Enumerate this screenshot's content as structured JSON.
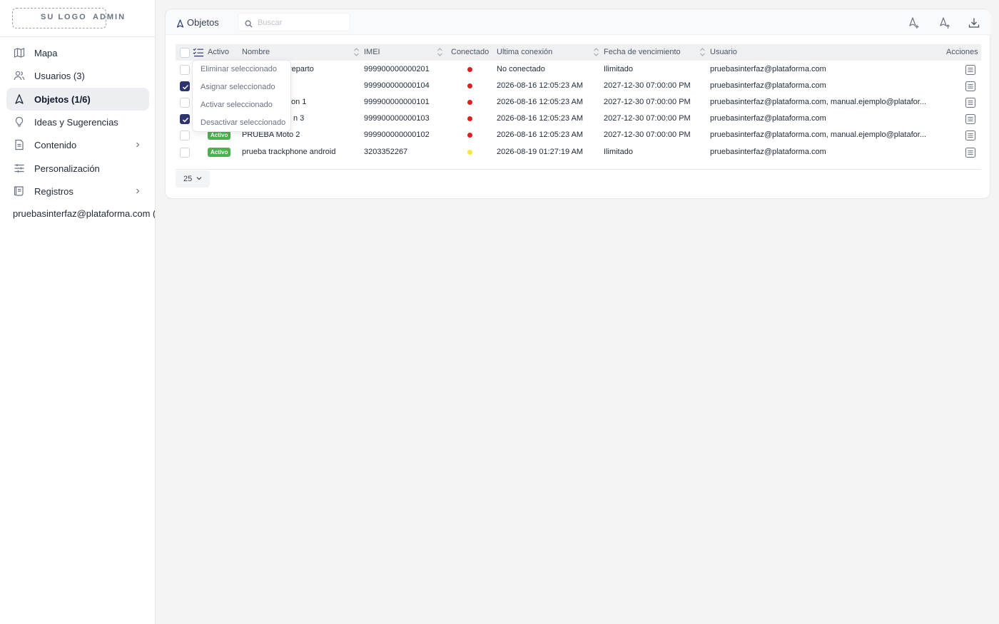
{
  "brand": {
    "logo": "SU LOGO",
    "role": "ADMIN"
  },
  "sidebar": {
    "items": [
      {
        "label": "Mapa",
        "icon": "map-icon"
      },
      {
        "label": "Usuarios (3)",
        "icon": "users-icon"
      },
      {
        "label": "Objetos (1/6)",
        "icon": "navigation-arrow-icon",
        "active": true
      },
      {
        "label": "Ideas y Sugerencias",
        "icon": "lightbulb-icon"
      },
      {
        "label": "Contenido",
        "icon": "file-icon",
        "expandable": true
      },
      {
        "label": "Personalización",
        "icon": "sliders-icon"
      },
      {
        "label": "Registros",
        "icon": "scroll-icon",
        "expandable": true
      }
    ],
    "user": "pruebasinterfaz@plataforma.com (D"
  },
  "header": {
    "title": "Objetos",
    "search_placeholder": "Buscar",
    "buttons": [
      "add-object-icon",
      "import-object-icon",
      "download-icon"
    ]
  },
  "table": {
    "columns": [
      "Activo",
      "Nombre",
      "IMEI",
      "Conectado",
      "Ultima conexión",
      "Fecha de vencimiento",
      "Usuario",
      "Acciones"
    ],
    "rows": [
      {
        "checked": false,
        "active": "",
        "name": "reparto",
        "imei": "999900000000201",
        "connected": "red",
        "last": "No conectado",
        "expiry": "Ilimitado",
        "user": "pruebasinterfaz@plataforma.com"
      },
      {
        "checked": true,
        "active": "",
        "name": "",
        "imei": "999900000000104",
        "connected": "red",
        "last": "2026-08-16 12:05:23 AM",
        "expiry": "2027-12-30 07:00:00 PM",
        "user": "pruebasinterfaz@plataforma.com"
      },
      {
        "checked": false,
        "active": "",
        "name": "on 1",
        "imei": "999900000000101",
        "connected": "red",
        "last": "2026-08-16 12:05:23 AM",
        "expiry": "2027-12-30 07:00:00 PM",
        "user": "pruebasinterfaz@plataforma.com, manual.ejemplo@platafor..."
      },
      {
        "checked": true,
        "active": "",
        "name": "n 3",
        "imei": "999900000000103",
        "connected": "red",
        "last": "2026-08-16 12:05:23 AM",
        "expiry": "2027-12-30 07:00:00 PM",
        "user": "pruebasinterfaz@plataforma.com"
      },
      {
        "checked": false,
        "active": "Activo",
        "name": "PRUEBA Moto 2",
        "imei": "999900000000102",
        "connected": "red",
        "last": "2026-08-16 12:05:23 AM",
        "expiry": "2027-12-30 07:00:00 PM",
        "user": "pruebasinterfaz@plataforma.com, manual.ejemplo@platafor..."
      },
      {
        "checked": false,
        "active": "Activo",
        "name": "prueba trackphone android",
        "imei": "3203352267",
        "connected": "yellow",
        "last": "2026-08-19 01:27:19 AM",
        "expiry": "Ilimitado",
        "user": "pruebasinterfaz@plataforma.com"
      }
    ],
    "page_size": "25"
  },
  "bulk_menu": {
    "items": [
      "Eliminar seleccionado",
      "Asignar seleccionado",
      "Activar seleccionado",
      "Desactivar seleccionado"
    ]
  },
  "colors": {
    "accent": "#2d3470",
    "status_red": "#e11d1d",
    "status_yellow": "#eeea3a",
    "badge_green": "#4caf50"
  }
}
